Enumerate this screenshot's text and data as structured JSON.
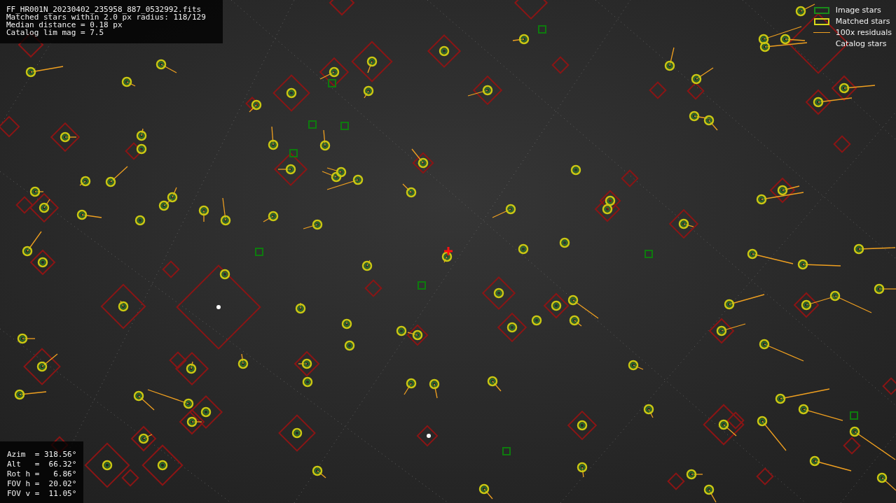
{
  "info": {
    "lines": [
      "FF_HR001N_20230402_235958_887_0532992.fits",
      "Matched stars within 2.0 px radius: 118/129",
      "Median distance = 0.18 px",
      "Catalog lim mag = 7.5"
    ]
  },
  "legend": [
    {
      "kind": "image",
      "label": "Image stars"
    },
    {
      "kind": "matched",
      "label": "Matched stars"
    },
    {
      "kind": "residual",
      "label": "100x residuals"
    },
    {
      "kind": "catalog",
      "label": "Catalog stars"
    }
  ],
  "pointing": {
    "lines": [
      "Azim  = 318.56°",
      "Alt   =  66.32°",
      "Rot h =   6.86°",
      "FOV h =  20.02°",
      "FOV v =  11.05°"
    ]
  }
}
